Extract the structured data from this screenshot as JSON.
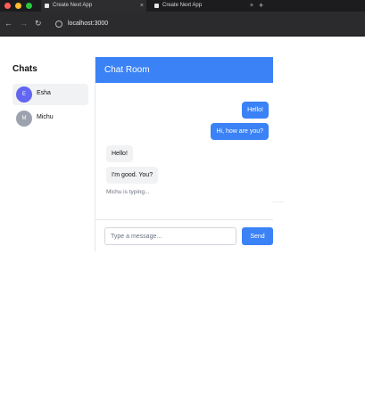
{
  "browser": {
    "tabs": [
      {
        "label": "Create Next App",
        "active": true
      },
      {
        "label": "Create Next App",
        "active": false
      }
    ],
    "new_tab_glyph": "+",
    "close_glyph": "×",
    "url": "localhost:3000",
    "traffic_colors": [
      "#ff5f57",
      "#febc2e",
      "#28c840"
    ]
  },
  "sidebar": {
    "title": "Chats",
    "contacts": [
      {
        "initial": "E",
        "name": "Esha",
        "avatar_color": "#6366f1",
        "active": true
      },
      {
        "initial": "M",
        "name": "Michu",
        "avatar_color": "#9ca3af",
        "active": false
      }
    ]
  },
  "chat": {
    "title": "Chat Room",
    "accent_color": "#3b82f6",
    "messages": [
      {
        "text": "Hello!",
        "direction": "out"
      },
      {
        "text": "Hi, how are you?",
        "direction": "out"
      },
      {
        "text": "Hello!",
        "direction": "in"
      },
      {
        "text": "I'm good. You?",
        "direction": "in"
      }
    ],
    "typing_text": "Michu is typing...",
    "input_placeholder": "Type a message...",
    "send_label": "Send"
  }
}
